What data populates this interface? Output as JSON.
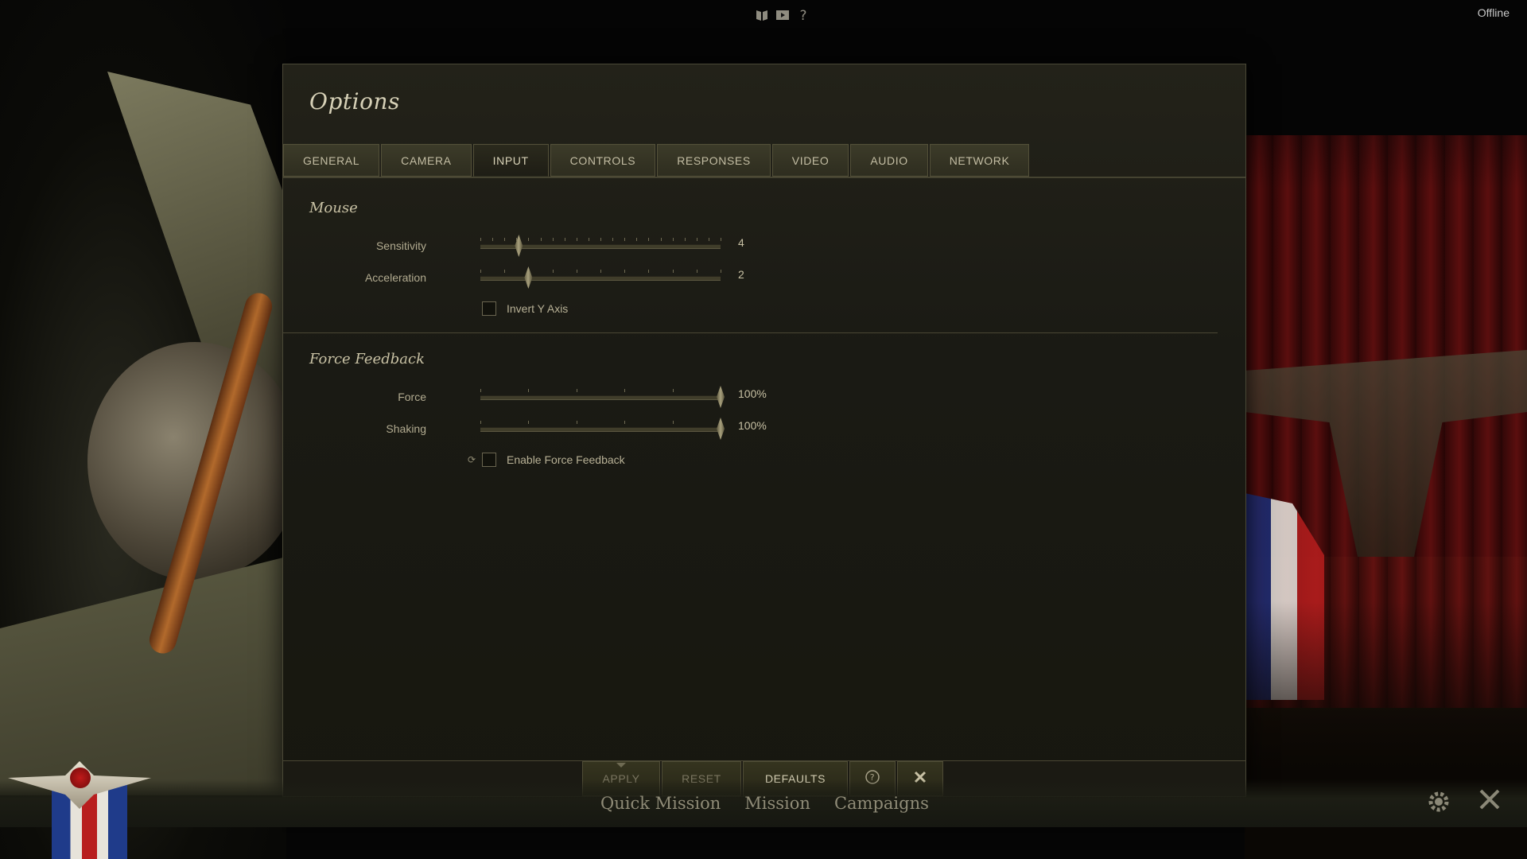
{
  "status": {
    "connection": "Offline"
  },
  "top_icons": [
    "book-icon",
    "film-icon",
    "help-icon"
  ],
  "dialog": {
    "title": "Options",
    "tabs": [
      {
        "label": "GENERAL"
      },
      {
        "label": "CAMERA"
      },
      {
        "label": "INPUT",
        "active": true
      },
      {
        "label": "CONTROLS"
      },
      {
        "label": "RESPONSES"
      },
      {
        "label": "VIDEO"
      },
      {
        "label": "AUDIO"
      },
      {
        "label": "NETWORK"
      }
    ],
    "mouse": {
      "title": "Mouse",
      "sensitivity": {
        "label": "Sensitivity",
        "value": "4",
        "level": 0.16
      },
      "acceleration": {
        "label": "Acceleration",
        "value": "2",
        "level": 0.2
      },
      "invert_y": {
        "label": "Invert Y Axis",
        "checked": false
      }
    },
    "force_feedback": {
      "title": "Force Feedback",
      "force": {
        "label": "Force",
        "value": "100%",
        "level": 1.0
      },
      "shaking": {
        "label": "Shaking",
        "value": "100%",
        "level": 1.0
      },
      "enable": {
        "label": "Enable Force Feedback",
        "checked": false
      }
    },
    "footer": {
      "apply": "APPLY",
      "reset": "RESET",
      "defaults": "DEFAULTS"
    }
  },
  "bottom_nav": {
    "items": [
      "Quick Mission",
      "Mission",
      "Campaigns"
    ]
  },
  "colors": {
    "panel_bg": "#1a1a14",
    "tab_bg": "#35341f",
    "text": "#c9c2a6",
    "border": "#4a4836"
  }
}
